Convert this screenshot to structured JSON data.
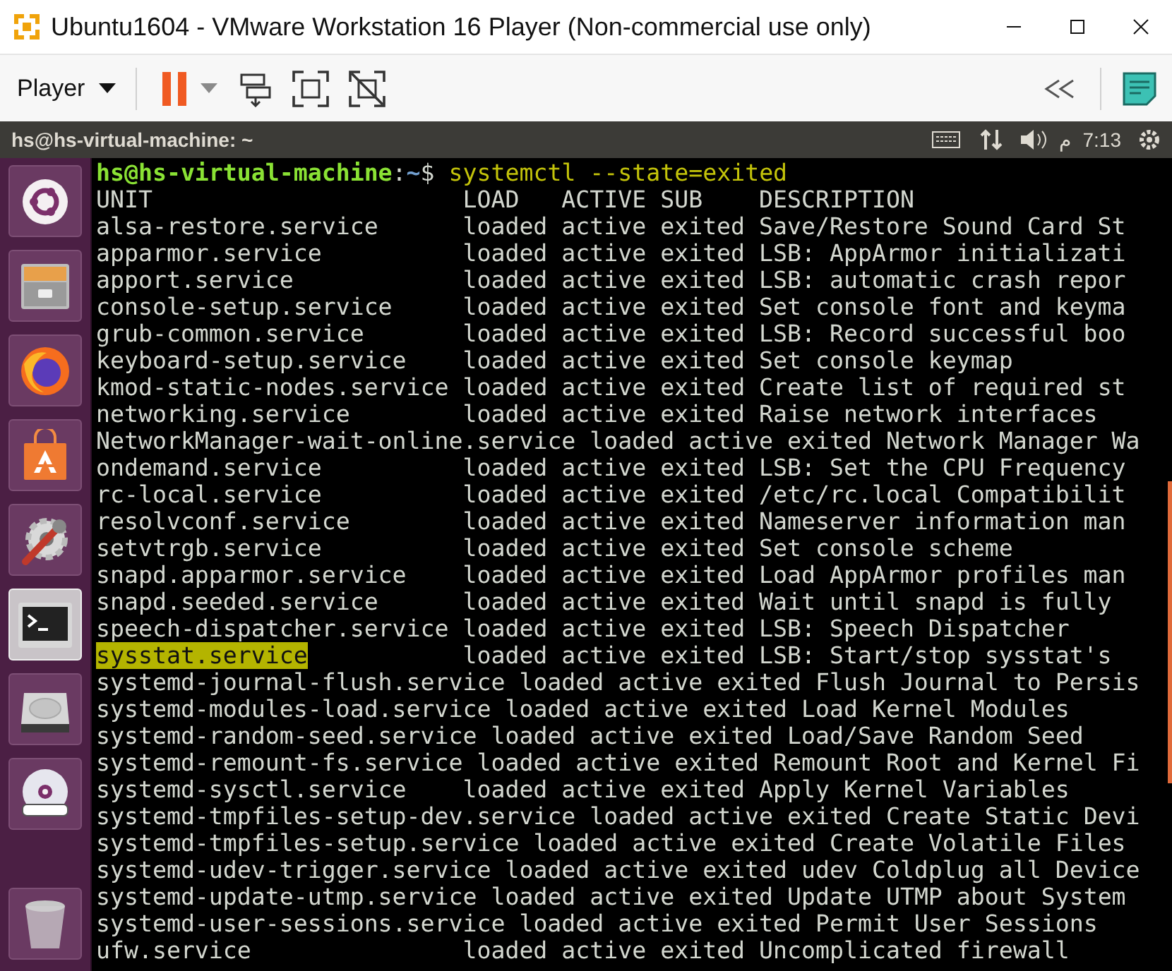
{
  "window": {
    "title": "Ubuntu1604 - VMware Workstation 16 Player (Non-commercial use only)"
  },
  "toolbar": {
    "player_menu": "Player"
  },
  "top_bar": {
    "title": "hs@hs-virtual-machine: ~",
    "indicator_text": "م",
    "clock": "7:13"
  },
  "launcher": [
    {
      "kind": "ubuntu",
      "selected": false
    },
    {
      "kind": "files",
      "selected": false
    },
    {
      "kind": "browser",
      "selected": false
    },
    {
      "kind": "store",
      "selected": false
    },
    {
      "kind": "settings",
      "selected": false
    },
    {
      "kind": "terminal",
      "selected": true
    },
    {
      "kind": "disk",
      "selected": false
    },
    {
      "kind": "dvd",
      "selected": false
    },
    {
      "kind": "trash",
      "selected": false
    }
  ],
  "terminal": {
    "prompt": {
      "user_host": "hs@hs-virtual-machine",
      "separator": ":",
      "path": "~",
      "symbol": "$",
      "command": "systemctl --state=exited"
    },
    "header": "UNIT                      LOAD   ACTIVE SUB    DESCRIPTION",
    "rows": [
      {
        "unit": "alsa-restore.service",
        "details": "loaded active exited Save/Restore Sound Card St",
        "selected": false
      },
      {
        "unit": "apparmor.service",
        "details": "loaded active exited LSB: AppArmor initializati",
        "selected": false
      },
      {
        "unit": "apport.service",
        "details": "loaded active exited LSB: automatic crash repor",
        "selected": false
      },
      {
        "unit": "console-setup.service",
        "details": "loaded active exited Set console font and keyma",
        "selected": false
      },
      {
        "unit": "grub-common.service",
        "details": "loaded active exited LSB: Record successful boo",
        "selected": false
      },
      {
        "unit": "keyboard-setup.service",
        "details": "loaded active exited Set console keymap",
        "selected": false
      },
      {
        "unit": "kmod-static-nodes.service",
        "details": "loaded active exited Create list of required st",
        "selected": false
      },
      {
        "unit": "networking.service",
        "details": "loaded active exited Raise network interfaces",
        "selected": false
      },
      {
        "unit": "NetworkManager-wait-online.service",
        "details": "loaded active exited Network Manager Wa",
        "selected": false
      },
      {
        "unit": "ondemand.service",
        "details": "loaded active exited LSB: Set the CPU Frequency",
        "selected": false
      },
      {
        "unit": "rc-local.service",
        "details": "loaded active exited /etc/rc.local Compatibilit",
        "selected": false
      },
      {
        "unit": "resolvconf.service",
        "details": "loaded active exited Nameserver information man",
        "selected": false
      },
      {
        "unit": "setvtrgb.service",
        "details": "loaded active exited Set console scheme",
        "selected": false
      },
      {
        "unit": "snapd.apparmor.service",
        "details": "loaded active exited Load AppArmor profiles man",
        "selected": false
      },
      {
        "unit": "snapd.seeded.service",
        "details": "loaded active exited Wait until snapd is fully",
        "selected": false
      },
      {
        "unit": "speech-dispatcher.service",
        "details": "loaded active exited LSB: Speech Dispatcher",
        "selected": false
      },
      {
        "unit": "sysstat.service",
        "details": "loaded active exited LSB: Start/stop sysstat's",
        "selected": true
      },
      {
        "unit": "systemd-journal-flush.service",
        "details": "loaded active exited Flush Journal to Persis",
        "selected": false
      },
      {
        "unit": "systemd-modules-load.service",
        "details": "loaded active exited Load Kernel Modules",
        "selected": false
      },
      {
        "unit": "systemd-random-seed.service",
        "details": "loaded active exited Load/Save Random Seed",
        "selected": false
      },
      {
        "unit": "systemd-remount-fs.service",
        "details": "loaded active exited Remount Root and Kernel Fi",
        "selected": false
      },
      {
        "unit": "systemd-sysctl.service",
        "details": "loaded active exited Apply Kernel Variables",
        "selected": false
      },
      {
        "unit": "systemd-tmpfiles-setup-dev.service",
        "details": "loaded active exited Create Static Devi",
        "selected": false
      },
      {
        "unit": "systemd-tmpfiles-setup.service",
        "details": "loaded active exited Create Volatile Files",
        "selected": false
      },
      {
        "unit": "systemd-udev-trigger.service",
        "details": "loaded active exited udev Coldplug all Device",
        "selected": false
      },
      {
        "unit": "systemd-update-utmp.service",
        "details": "loaded active exited Update UTMP about System",
        "selected": false
      },
      {
        "unit": "systemd-user-sessions.service",
        "details": "loaded active exited Permit User Sessions",
        "selected": false
      },
      {
        "unit": "ufw.service",
        "details": "loaded active exited Uncomplicated firewall",
        "selected": false
      }
    ]
  }
}
